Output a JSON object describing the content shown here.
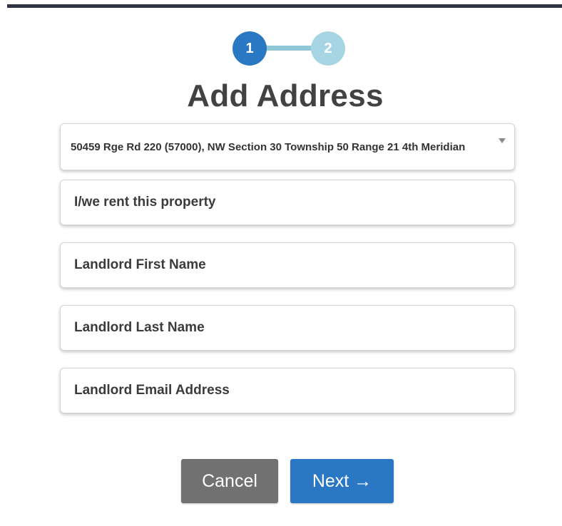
{
  "stepper": {
    "step1": "1",
    "step2": "2"
  },
  "title": "Add Address",
  "address_select": {
    "value": "50459 Rge Rd 220 (57000), NW Section 30 Township 50 Range 21 4th Meridian"
  },
  "fields": {
    "rent": "I/we rent this property",
    "landlord_first_name": "Landlord First Name",
    "landlord_last_name": "Landlord Last Name",
    "landlord_email": "Landlord Email Address"
  },
  "buttons": {
    "cancel": "Cancel",
    "next": "Next →"
  },
  "colors": {
    "primary": "#2a77c3",
    "step_inactive": "#a8d5e3",
    "cancel": "#717171"
  }
}
